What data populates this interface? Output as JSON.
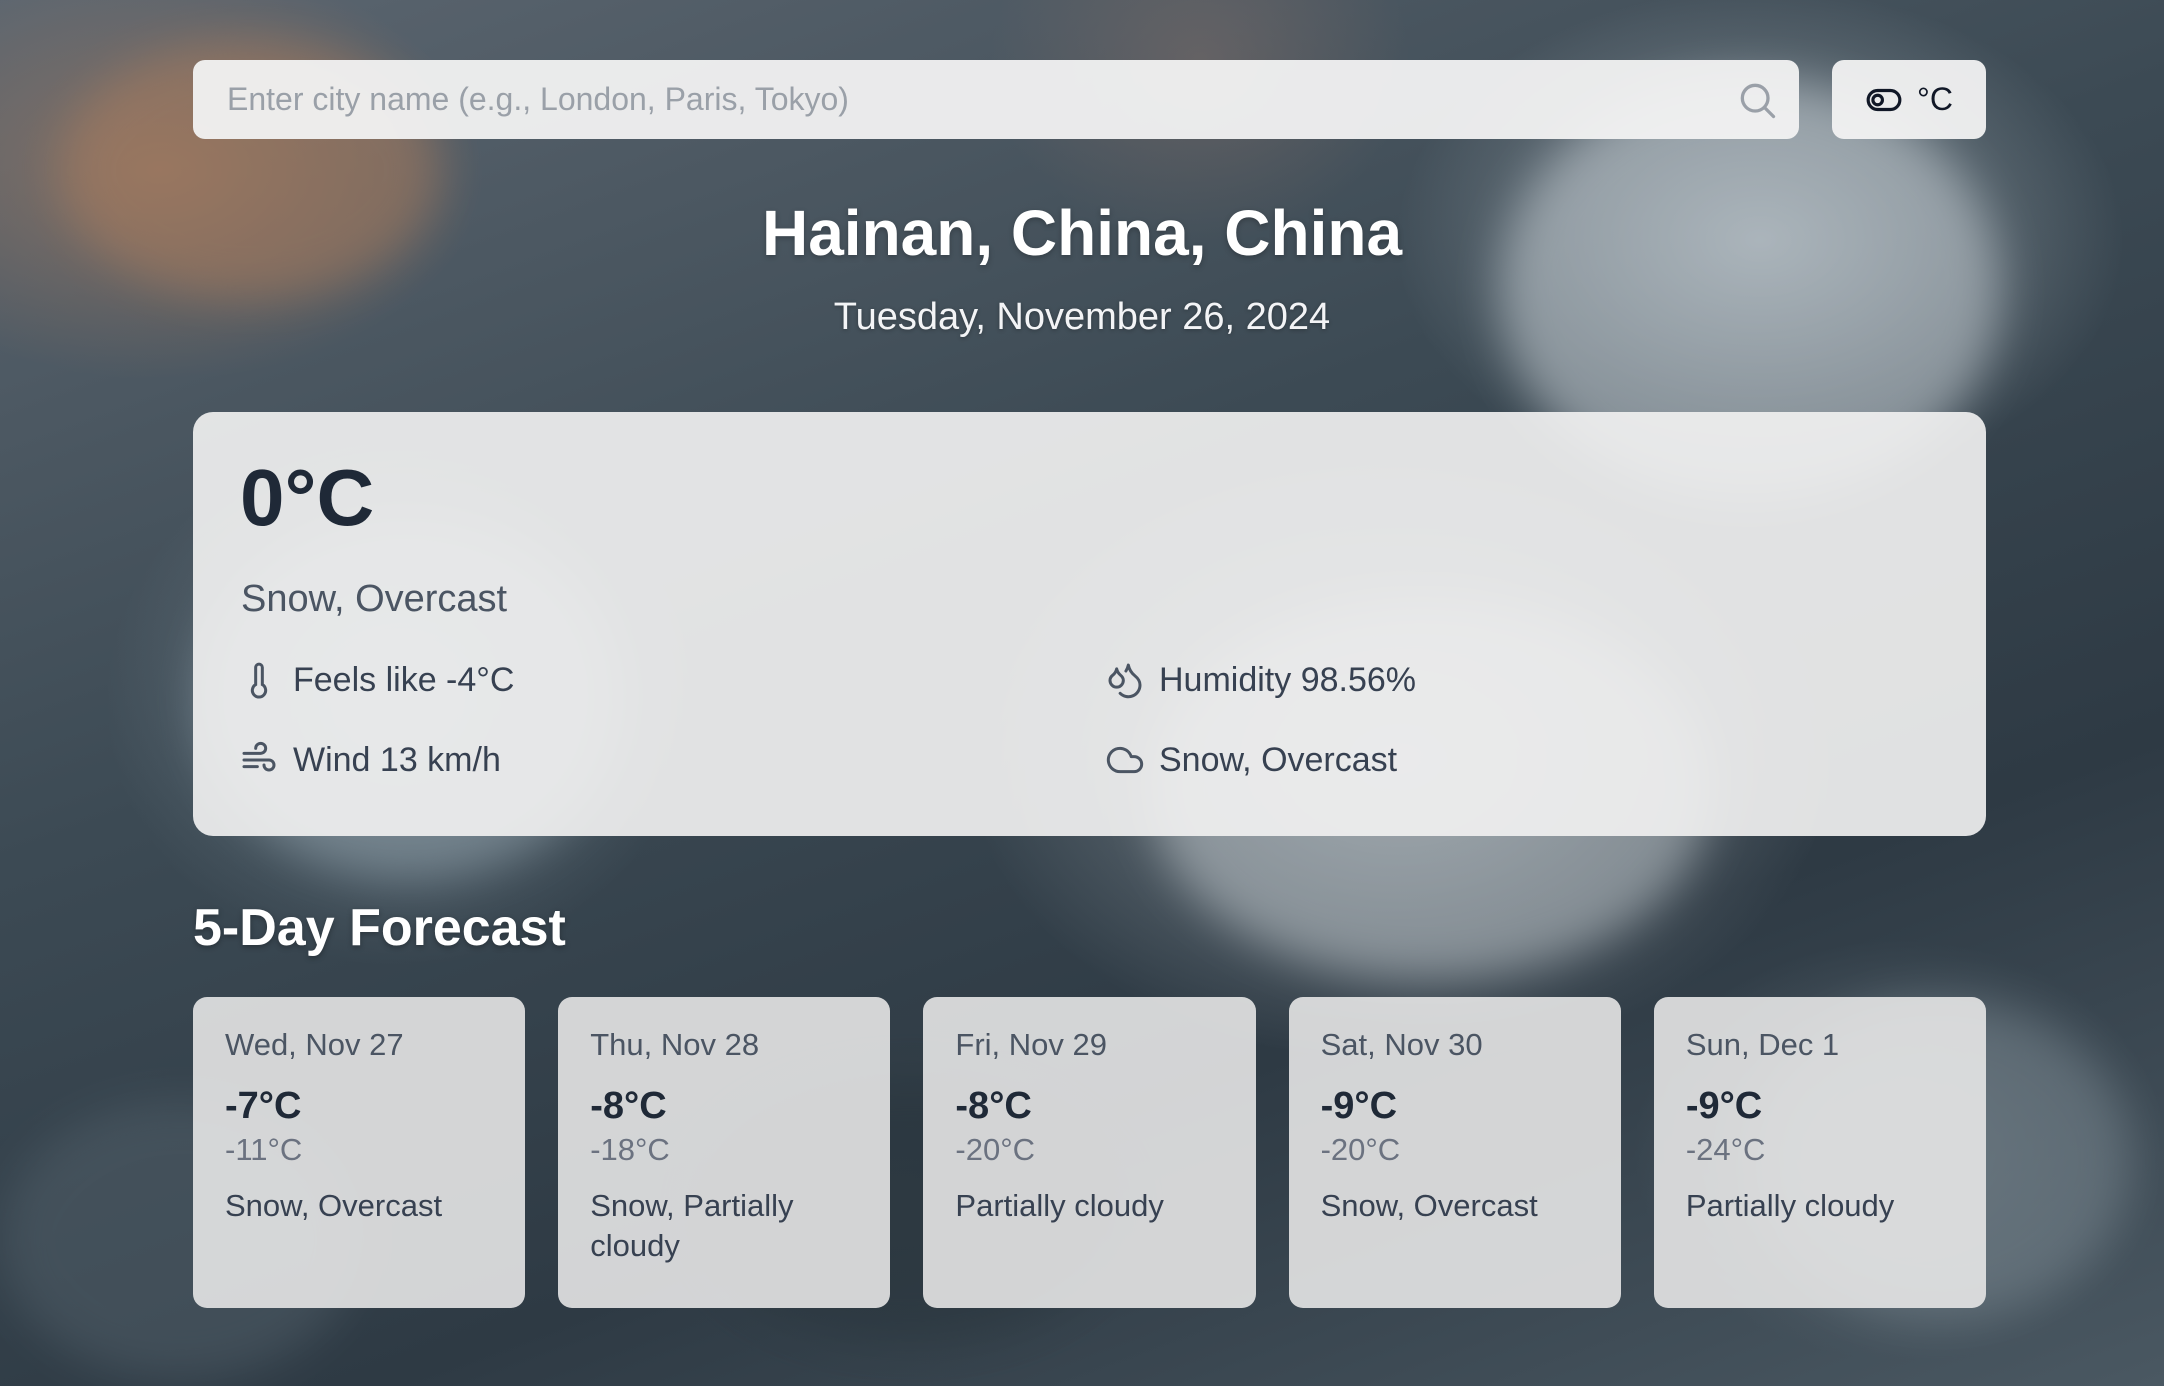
{
  "search": {
    "placeholder": "Enter city name (e.g., London, Paris, Tokyo)",
    "value": ""
  },
  "unit_toggle": {
    "label": "°C"
  },
  "location": {
    "name": "Hainan, China, China",
    "date": "Tuesday, November 26, 2024"
  },
  "current": {
    "temperature": "0°C",
    "condition": "Snow, Overcast",
    "feels_like": "Feels like -4°C",
    "wind": "Wind 13 km/h",
    "humidity": "Humidity 98.56%",
    "condition_detail": "Snow, Overcast"
  },
  "forecast": {
    "title": "5-Day Forecast",
    "days": [
      {
        "date": "Wed, Nov 27",
        "high": "-7°C",
        "low": "-11°C",
        "condition": "Snow, Overcast"
      },
      {
        "date": "Thu, Nov 28",
        "high": "-8°C",
        "low": "-18°C",
        "condition": "Snow, Partially cloudy"
      },
      {
        "date": "Fri, Nov 29",
        "high": "-8°C",
        "low": "-20°C",
        "condition": "Partially cloudy"
      },
      {
        "date": "Sat, Nov 30",
        "high": "-9°C",
        "low": "-20°C",
        "condition": "Snow, Overcast"
      },
      {
        "date": "Sun, Dec 1",
        "high": "-9°C",
        "low": "-24°C",
        "condition": "Partially cloudy"
      }
    ]
  },
  "icons": {
    "search": "search-icon",
    "toggle": "toggle-icon",
    "thermometer": "thermometer-icon",
    "wind": "wind-icon",
    "humidity": "droplets-icon",
    "cloud": "cloud-icon"
  },
  "colors": {
    "card_bg": "#f0f0f0",
    "text_dark": "#1f2937",
    "text_muted": "#4b5563",
    "heading_light": "#ffffff"
  }
}
